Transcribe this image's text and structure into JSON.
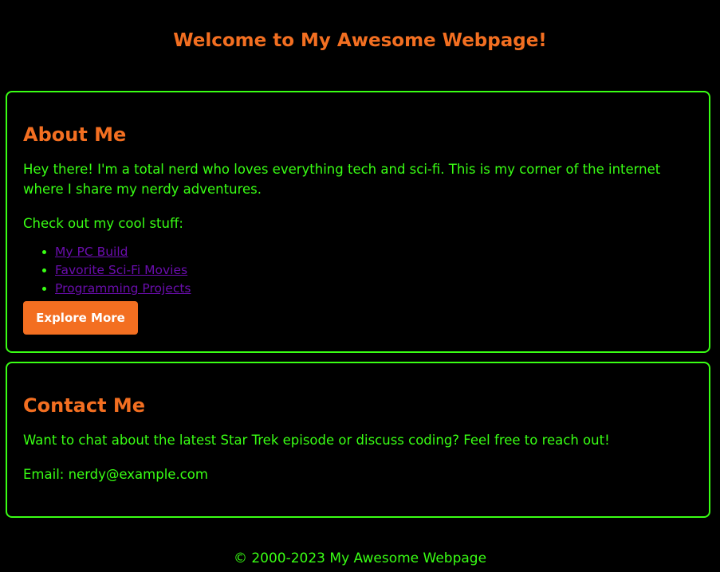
{
  "header": {
    "title": "Welcome to My Awesome Webpage!"
  },
  "about": {
    "heading": "About Me",
    "intro": "Hey there! I'm a total nerd who loves everything tech and sci-fi. This is my corner of the internet where I share my nerdy adventures.",
    "stuff_label": "Check out my cool stuff:",
    "links": [
      {
        "label": "My PC Build"
      },
      {
        "label": "Favorite Sci-Fi Movies"
      },
      {
        "label": "Programming Projects"
      }
    ],
    "button_label": "Explore More"
  },
  "contact": {
    "heading": "Contact Me",
    "text": "Want to chat about the latest Star Trek episode or discuss coding? Feel free to reach out!",
    "email": "Email: nerdy@example.com"
  },
  "footer": {
    "text": "© 2000-2023 My Awesome Webpage"
  },
  "colors": {
    "background": "#000000",
    "accent": "#f36f21",
    "text": "#39ff14",
    "link": "#6a0dad"
  }
}
